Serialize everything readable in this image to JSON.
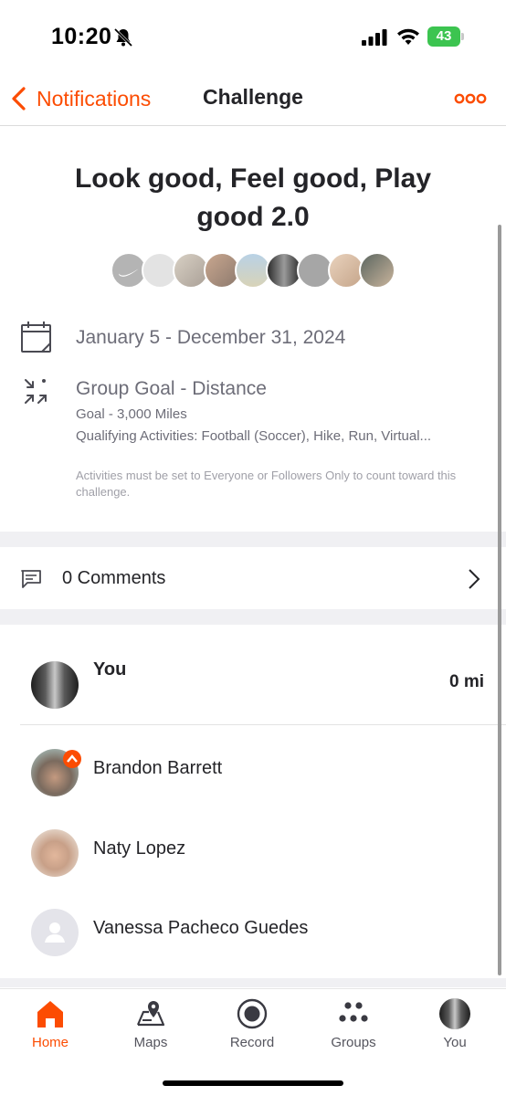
{
  "status_bar": {
    "time": "10:20",
    "battery": "43"
  },
  "nav": {
    "back_label": "Notifications",
    "title": "Challenge",
    "more_icon": "more-horizontal-icon"
  },
  "challenge": {
    "title": "Look good, Feel good, Play good 2.0",
    "dates": "January 5 - December 31, 2024",
    "goal_type": "Group Goal - Distance",
    "goal": "Goal - 3,000 Miles",
    "qualifying": "Qualifying Activities: Football (Soccer), Hike, Run, Virtual...",
    "disclaimer": "Activities must be set to Everyone or Followers Only to count toward this challenge."
  },
  "comments": {
    "label": "0 Comments"
  },
  "leaderboard": [
    {
      "name": "You",
      "value": "0 mi"
    },
    {
      "name": "Brandon Barrett"
    },
    {
      "name": "Naty Lopez"
    },
    {
      "name": "Vanessa Pacheco Guedes"
    }
  ],
  "tabs": [
    {
      "label": "Home",
      "icon": "home-icon",
      "active": true
    },
    {
      "label": "Maps",
      "icon": "map-icon"
    },
    {
      "label": "Record",
      "icon": "record-icon"
    },
    {
      "label": "Groups",
      "icon": "groups-icon"
    },
    {
      "label": "You",
      "icon": "profile-avatar"
    }
  ],
  "colors": {
    "accent": "#fc4c02",
    "text": "#242428",
    "muted": "#6d6d78"
  }
}
